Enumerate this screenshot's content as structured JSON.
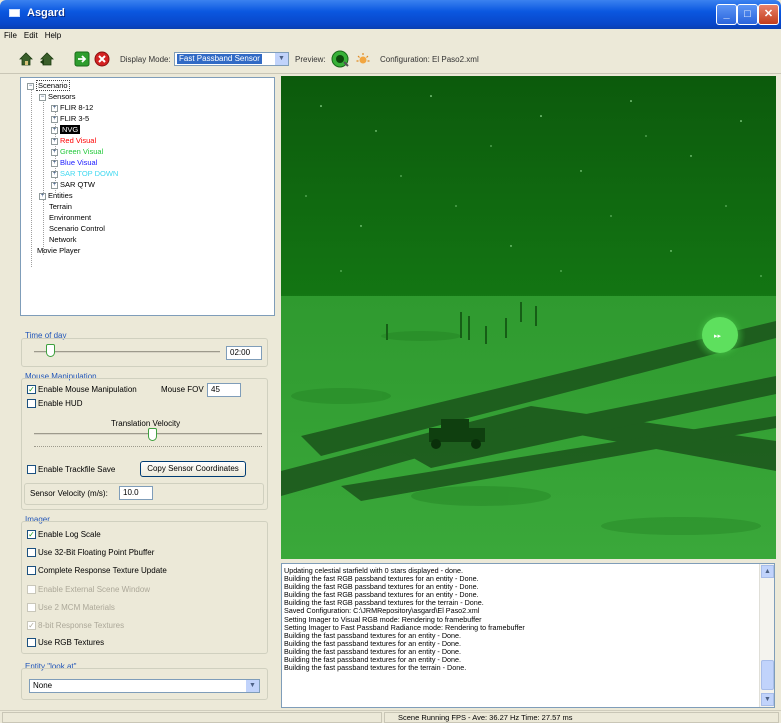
{
  "window": {
    "title": "Asgard",
    "minimize_label": "_",
    "maximize_label": "□",
    "close_label": "✕"
  },
  "menu": [
    "File",
    "Edit",
    "Help"
  ],
  "toolbar": {
    "display_mode_label": "Display Mode:",
    "display_mode_value": "Fast Passband Sensor",
    "preview_label": "Preview:",
    "configuration_label": "Configuration: El Paso2.xml"
  },
  "tree": {
    "root": "Scenario",
    "sensors": "Sensors",
    "sensor_items": [
      {
        "label": "FLIR 8-12",
        "color": "#000000",
        "highlight": false
      },
      {
        "label": "FLIR 3-5",
        "color": "#000000",
        "highlight": false
      },
      {
        "label": "NVG",
        "color": "#ffffff",
        "highlight": true
      },
      {
        "label": "Red Visual",
        "color": "#ff0000",
        "highlight": false
      },
      {
        "label": "Green Visual",
        "color": "#22c83a",
        "highlight": false
      },
      {
        "label": "Blue Visual",
        "color": "#1a1aff",
        "highlight": false
      },
      {
        "label": "SAR TOP DOWN",
        "color": "#40d8f0",
        "highlight": false
      },
      {
        "label": "SAR QTW",
        "color": "#000000",
        "highlight": false
      }
    ],
    "other_items": [
      "Entities",
      "Terrain",
      "Environment",
      "Scenario Control",
      "Network"
    ],
    "movie_player": "Movie Player"
  },
  "time_of_day": {
    "header": "Time of day",
    "value": "02:00"
  },
  "mouse": {
    "header": "Mouse Manipulation",
    "enable_manip": "Enable Mouse Manipulation",
    "fov_label": "Mouse FOV",
    "fov_value": "45",
    "enable_hud": "Enable HUD",
    "translation_label": "Translation Velocity",
    "enable_trackfile": "Enable Trackfile Save",
    "copy_coords": "Copy Sensor Coordinates",
    "sensor_velocity_label": "Sensor Velocity (m/s):",
    "sensor_velocity_value": "10.0"
  },
  "imager": {
    "header": "Imager",
    "options": [
      {
        "label": "Enable Log Scale",
        "checked": true,
        "disabled": false
      },
      {
        "label": "Use 32-Bit Floating Point Pbuffer",
        "checked": false,
        "disabled": false
      },
      {
        "label": "Complete Response Texture Update",
        "checked": false,
        "disabled": false
      },
      {
        "label": "Enable External Scene Window",
        "checked": false,
        "disabled": true
      },
      {
        "label": "Use 2 MCM Materials",
        "checked": false,
        "disabled": true
      },
      {
        "label": "8-bit Response Textures",
        "checked": true,
        "disabled": true
      },
      {
        "label": "Use RGB Textures",
        "checked": false,
        "disabled": false
      }
    ]
  },
  "entity_look_at": {
    "header": "Entity \"look at\"",
    "value": "None"
  },
  "log": [
    "Updating celestial starfield  with 0 stars displayed - done.",
    "Building the fast RGB passband textures for an entity  - Done.",
    "Building the fast RGB passband textures for an entity  - Done.",
    "Building the fast RGB passband textures for an entity  - Done.",
    "Building the fast RGB passband textures for the terrain  - Done.",
    "Saved Configuration: C:\\JRMRepository\\asgard\\El Paso2.xml",
    "Setting Imager to Visual RGB mode: Rendering to framebuffer",
    "Setting Imager to Fast Passband Radiance mode: Rendering to framebuffer",
    "Building the fast passband textures for an entity  - Done.",
    "Building the fast passband textures for an entity  - Done.",
    "Building the fast passband textures for an entity  - Done.",
    "Building the fast passband textures for an entity  - Done.",
    "Building the fast passband textures for the terrain  - Done."
  ],
  "status": "Scene Running FPS - Ave: 36.27 Hz Time: 27.57 ms",
  "colors": {
    "accent": "#316ac5",
    "night_vision": "#1d8f1d",
    "sky": "#116a11"
  }
}
